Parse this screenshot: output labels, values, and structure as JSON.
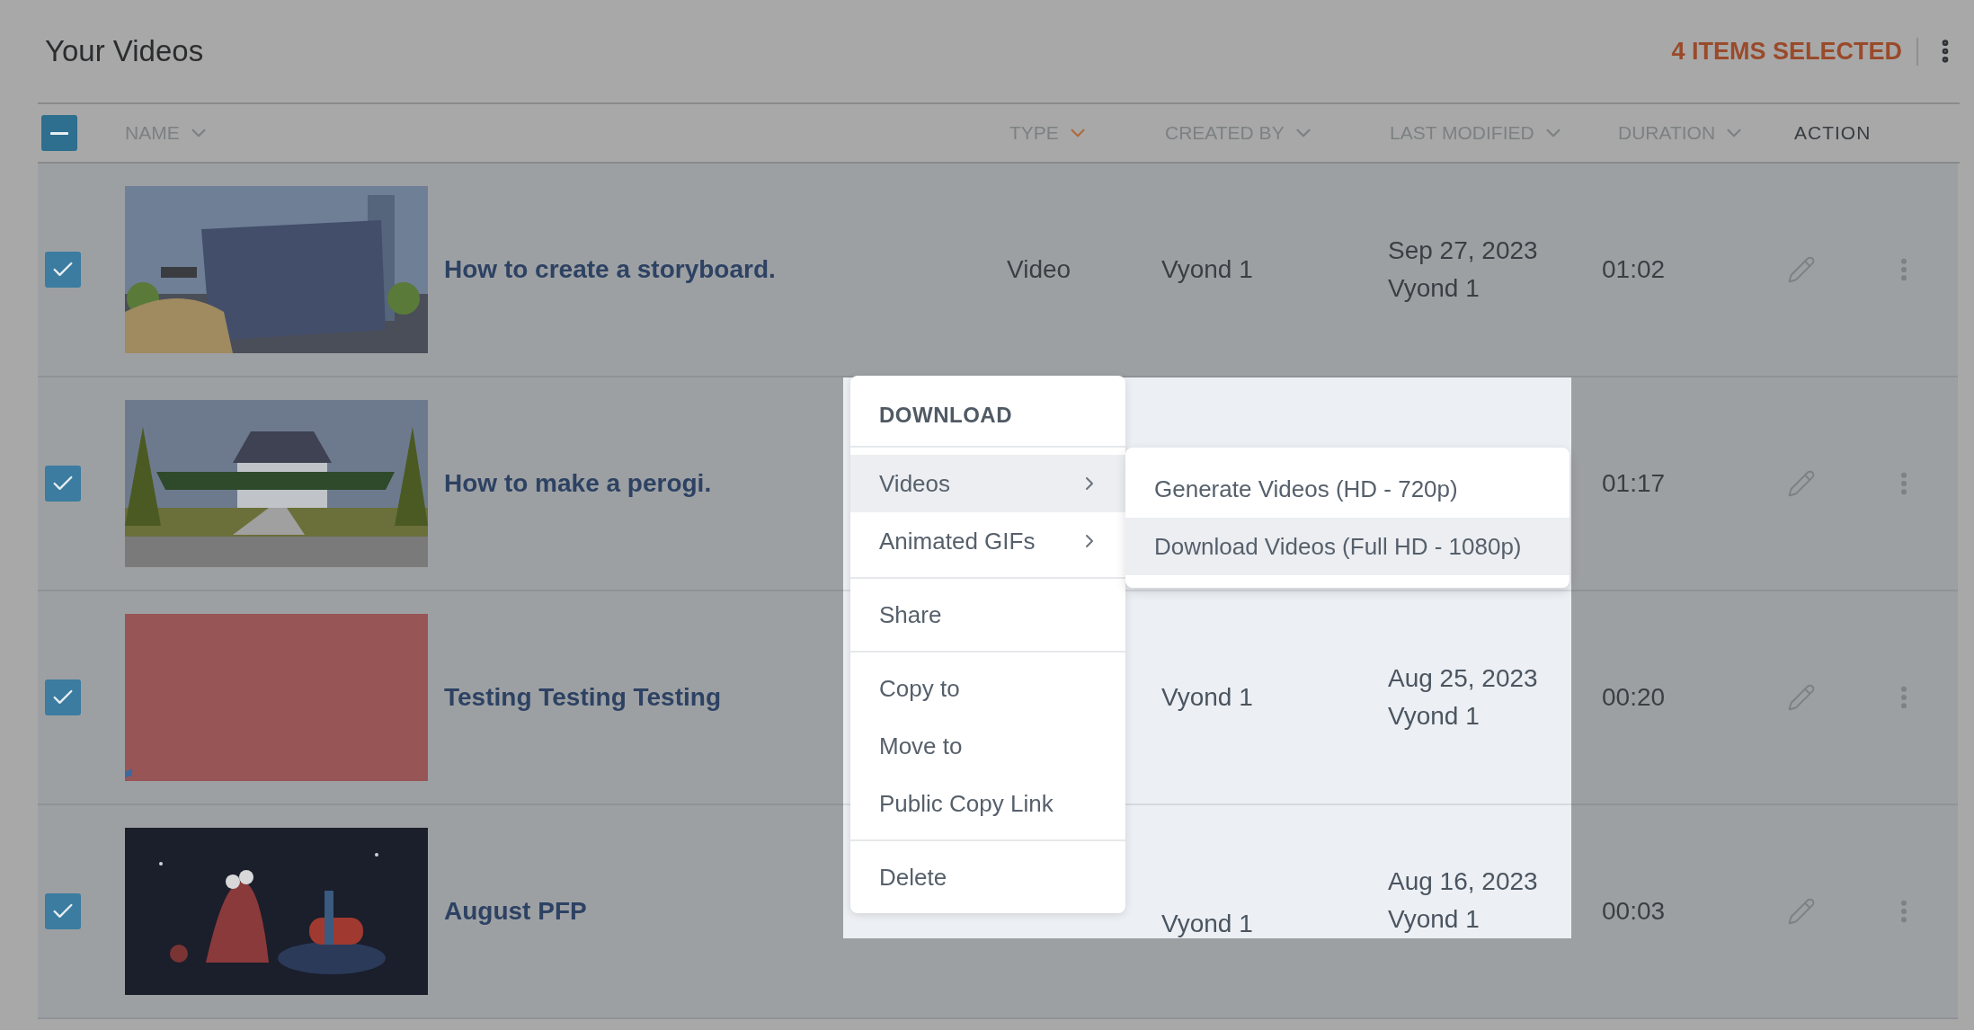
{
  "header": {
    "title": "Your Videos",
    "selection_count": "4 ITEMS SELECTED"
  },
  "select_all": {
    "indeterminate": true
  },
  "columns": [
    {
      "kind": "sortable",
      "label": "NAME",
      "sorted": false
    },
    {
      "kind": "sortable",
      "label": "TYPE",
      "sorted": true
    },
    {
      "kind": "sortable",
      "label": "CREATED BY",
      "sorted": false
    },
    {
      "kind": "sortable",
      "label": "LAST MODIFIED",
      "sorted": false
    },
    {
      "kind": "sortable",
      "label": "DURATION",
      "sorted": false
    },
    {
      "kind": "plain",
      "label": "ACTION"
    }
  ],
  "rows": [
    {
      "checked": true,
      "thumbnail": {
        "kind": "picture"
      },
      "name": "How to create a storyboard.",
      "type": "Video",
      "created_by": "Vyond 1",
      "modified": [
        "Sep 27, 2023",
        "Vyond 1"
      ],
      "duration": "01:02",
      "dimmed": true
    },
    {
      "checked": true,
      "thumbnail": {
        "kind": "picture"
      },
      "name": "How to make a perogi.",
      "modified": [],
      "duration": "01:17",
      "dimmed": false
    },
    {
      "checked": true,
      "thumbnail": {
        "kind": "picture"
      },
      "name": "Testing Testing Testing",
      "created_by": "Vyond 1",
      "modified": [
        "Aug 25, 2023",
        "Vyond 1"
      ],
      "duration": "00:20",
      "dimmed": false
    },
    {
      "checked": true,
      "thumbnail": {
        "kind": "picture"
      },
      "name": "August PFP",
      "created_by": "Vyond 1",
      "modified": [
        "Aug 16, 2023",
        "Vyond 1"
      ],
      "duration": "00:03",
      "dimmed": false
    }
  ],
  "menu": {
    "heading": "DOWNLOAD",
    "groups": [
      [
        {
          "label": "Videos",
          "submenu": true,
          "selected": true
        },
        {
          "label": "Animated GIFs",
          "submenu": true,
          "selected": false
        }
      ],
      [
        {
          "label": "Share",
          "submenu": false,
          "selected": false
        }
      ],
      [
        {
          "label": "Copy to",
          "submenu": false,
          "selected": false
        },
        {
          "label": "Move to",
          "submenu": false,
          "selected": false
        },
        {
          "label": "Public Copy Link",
          "submenu": false,
          "selected": false
        }
      ],
      [
        {
          "label": "Delete",
          "submenu": false,
          "selected": false
        }
      ]
    ],
    "submenu": [
      {
        "label": "Generate Videos (HD - 720p)",
        "selected": false
      },
      {
        "label": "Download Videos (Full HD - 1080p)",
        "selected": true
      }
    ]
  }
}
